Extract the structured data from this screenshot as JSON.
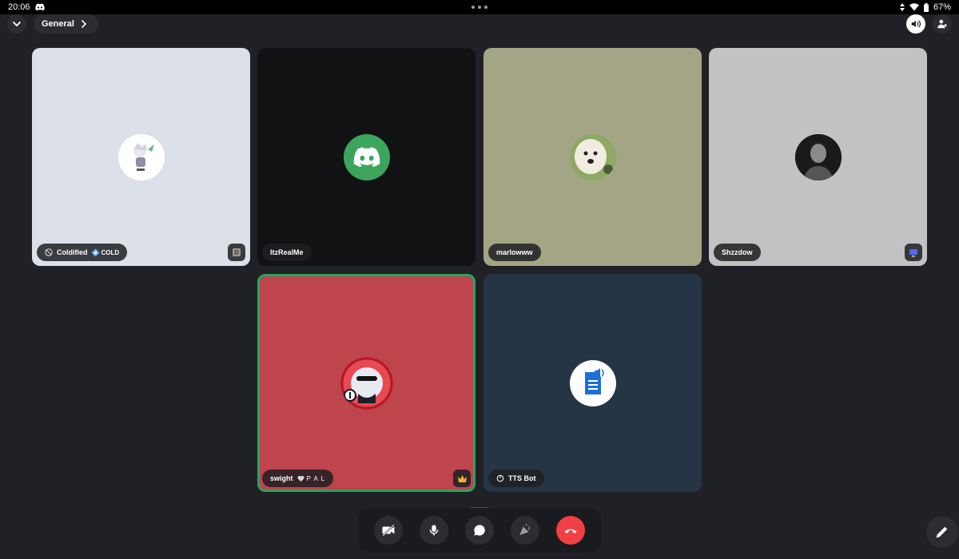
{
  "status_bar": {
    "time": "20:06",
    "battery": "67%"
  },
  "header": {
    "channel_name": "General"
  },
  "participants": [
    {
      "name": "Coldified",
      "tag": "COLD"
    },
    {
      "name": "ItzRealMe"
    },
    {
      "name": "marlowww"
    },
    {
      "name": "Shzzdow"
    },
    {
      "name": "swight",
      "tag": "P A L"
    },
    {
      "name": "TTS Bot"
    }
  ],
  "icons": {
    "collapse": "chevron-down-icon",
    "speaker": "speaker-icon",
    "add_user": "add-user-icon",
    "camera_off": "camera-off-icon",
    "mic": "microphone-icon",
    "chat": "chat-bubble-icon",
    "soundboard": "soundboard-icon",
    "end_call": "phone-hangup-icon",
    "draw": "pencil-icon"
  },
  "colors": {
    "background": "#202127",
    "speaking_outline": "#23a55a",
    "end_call": "#f23f43",
    "tile_coldified": "#dce1e9",
    "tile_itzrealme": "#111214",
    "tile_marlowww": "#a3a584",
    "tile_shzzdow": "#c2c2c2",
    "tile_swight": "#be444e",
    "tile_ttsbot": "#253545"
  }
}
